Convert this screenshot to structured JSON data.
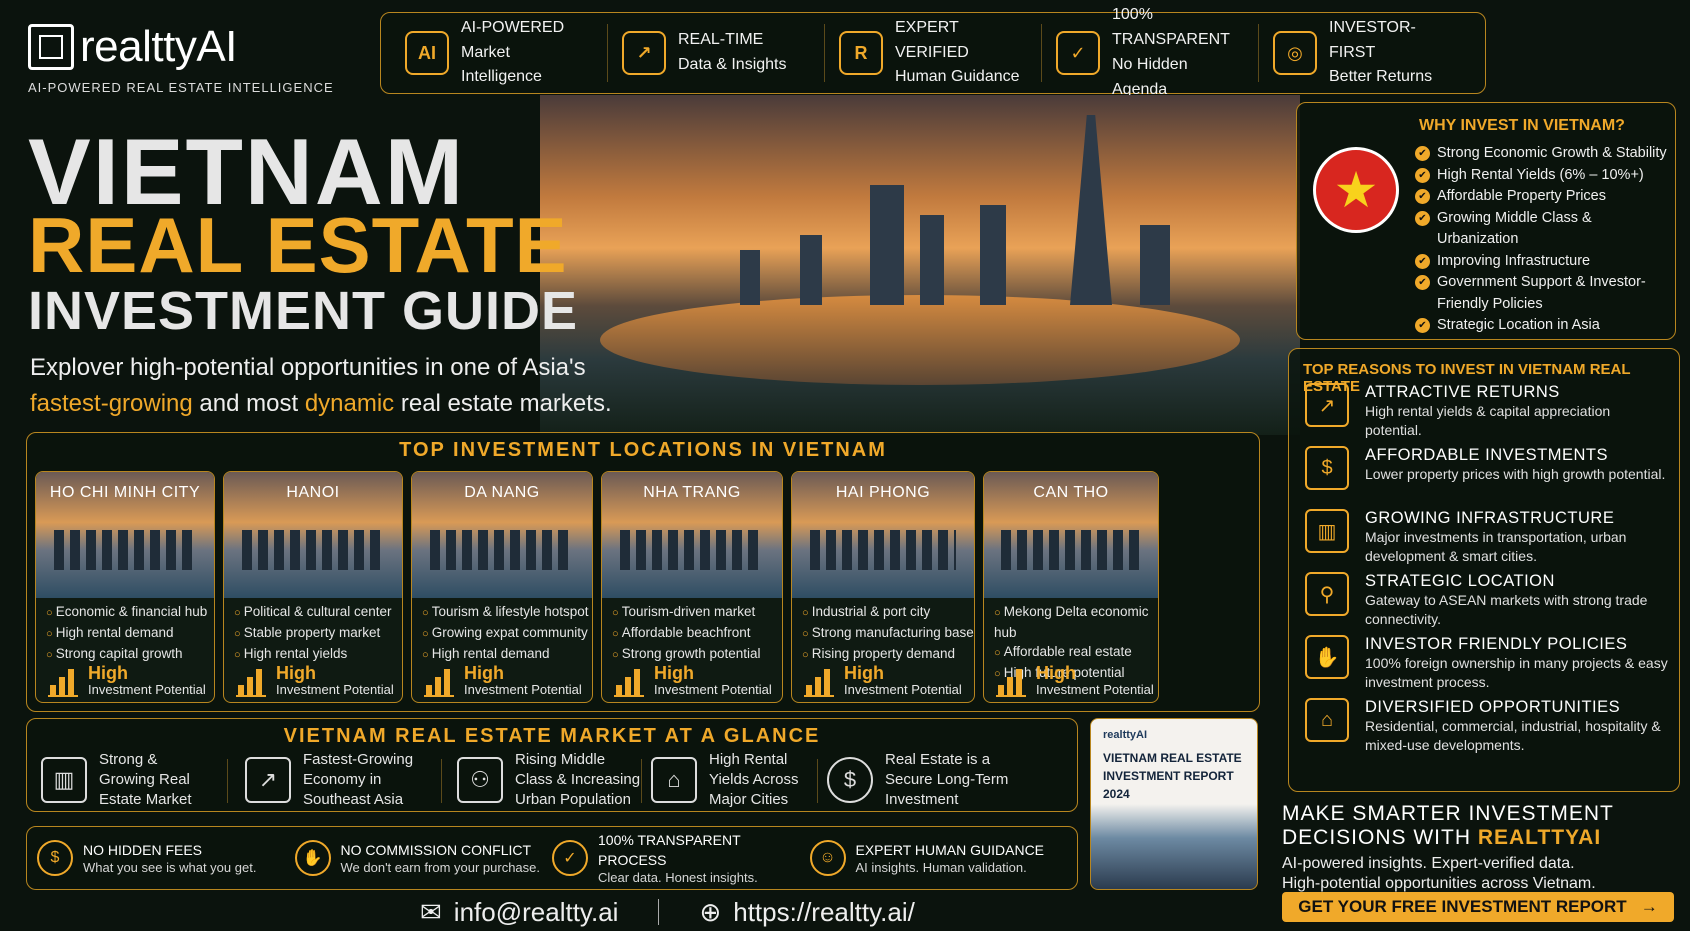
{
  "brand": {
    "name": "realttyAI",
    "tagline": "AI-POWERED REAL ESTATE INTELLIGENCE"
  },
  "features": [
    {
      "icon": "ai-chip-icon",
      "line1": "AI-POWERED",
      "line2": "Market Intelligence"
    },
    {
      "icon": "growth-chart-icon",
      "line1": "REAL-TIME",
      "line2": "Data & Insights"
    },
    {
      "icon": "expert-icon",
      "line1": "EXPERT VERIFIED",
      "line2": "Human Guidance"
    },
    {
      "icon": "shield-check-icon",
      "line1": "100% TRANSPARENT",
      "line2": "No Hidden Agenda"
    },
    {
      "icon": "target-icon",
      "line1": "INVESTOR-FIRST",
      "line2": "Better Returns"
    }
  ],
  "hero": {
    "title1": "VIETNAM",
    "title2": "REAL ESTATE",
    "title3": "INVESTMENT GUIDE",
    "subtitle_a": "Explover high-potential opportunities in one of Asia's",
    "subtitle_h1": "fastest-growing",
    "subtitle_b": " and most ",
    "subtitle_h2": "dynamic",
    "subtitle_c": " real estate markets."
  },
  "locations": {
    "title": "TOP INVESTMENT LOCATIONS IN VIETNAM",
    "cards": [
      {
        "name": "HO CHI MINH CITY",
        "points": [
          "Economic & financial hub",
          "High rental demand",
          "Strong capital growth"
        ],
        "potential": "High",
        "potential_label": "Investment Potential"
      },
      {
        "name": "HANOI",
        "points": [
          "Political & cultural center",
          "Stable property market",
          "High rental yields"
        ],
        "potential": "High",
        "potential_label": "Investment Potential"
      },
      {
        "name": "DA NANG",
        "points": [
          "Tourism & lifestyle hotspot",
          "Growing expat community",
          "High rental demand"
        ],
        "potential": "High",
        "potential_label": "Investment Potential"
      },
      {
        "name": "NHA TRANG",
        "points": [
          "Tourism-driven market",
          "Affordable beachfront",
          "Strong growth potential"
        ],
        "potential": "High",
        "potential_label": "Investment Potential"
      },
      {
        "name": "HAI PHONG",
        "points": [
          "Industrial & port city",
          "Strong manufacturing base",
          "Rising property demand"
        ],
        "potential": "High",
        "potential_label": "Investment Potential"
      },
      {
        "name": "CAN THO",
        "points": [
          "Mekong Delta economic hub",
          "Affordable real estate",
          "High future potential"
        ],
        "potential": "High",
        "potential_label": "Investment Potential"
      }
    ]
  },
  "glance": {
    "title": "VIETNAM REAL ESTATE MARKET AT A GLANCE",
    "items": [
      {
        "icon": "buildings-icon",
        "text": "Strong & Growing Real Estate Market"
      },
      {
        "icon": "growth-chart-icon",
        "text": "Fastest-Growing Economy in Southeast Asia"
      },
      {
        "icon": "people-icon",
        "text": "Rising Middle Class & Increasing Urban Population"
      },
      {
        "icon": "house-icon",
        "text": "High Rental Yields Across Major Cities"
      },
      {
        "icon": "dollar-icon",
        "text": "Real Estate is a Secure Long-Term Investment"
      }
    ]
  },
  "trust": [
    {
      "icon": "no-fees-icon",
      "title": "NO HIDDEN FEES",
      "sub": "What you see is what you get."
    },
    {
      "icon": "handshake-icon",
      "title": "NO COMMISSION CONFLICT",
      "sub": "We don't earn from your purchase."
    },
    {
      "icon": "shield-check-icon",
      "title": "100% TRANSPARENT PROCESS",
      "sub": "Clear data. Honest insights."
    },
    {
      "icon": "expert-icon",
      "title": "EXPERT HUMAN GUIDANCE",
      "sub": "AI insights. Human validation."
    }
  ],
  "report": {
    "brand": "realttyAI",
    "title": "VIETNAM REAL ESTATE INVESTMENT REPORT 2024"
  },
  "why": {
    "title": "WHY INVEST IN VIETNAM?",
    "items": [
      "Strong Economic Growth & Stability",
      "High Rental Yields (6% – 10%+)",
      "Affordable Property Prices",
      "Growing Middle Class & Urbanization",
      "Improving Infrastructure",
      "Government Support & Investor-Friendly Policies",
      "Strategic Location in Asia"
    ]
  },
  "reasons": {
    "title": "TOP REASONS TO INVEST IN VIETNAM REAL ESTATE",
    "items": [
      {
        "icon": "growth-chart-icon",
        "head": "ATTRACTIVE RETURNS",
        "desc": "High rental yields & capital appreciation potential."
      },
      {
        "icon": "dollar-hand-icon",
        "head": "AFFORDABLE INVESTMENTS",
        "desc": "Lower property prices with high growth potential."
      },
      {
        "icon": "buildings-icon",
        "head": "GROWING INFRASTRUCTURE",
        "desc": "Major investments in transportation, urban development & smart cities."
      },
      {
        "icon": "location-pin-icon",
        "head": "STRATEGIC LOCATION",
        "desc": "Gateway to ASEAN markets with strong trade connectivity."
      },
      {
        "icon": "handshake-icon",
        "head": "INVESTOR FRIENDLY POLICIES",
        "desc": "100% foreign ownership in many projects & easy investment process."
      },
      {
        "icon": "house-icon",
        "head": "DIVERSIFIED OPPORTUNITIES",
        "desc": "Residential, commercial, industrial, hospitality & mixed-use developments."
      }
    ]
  },
  "smart": {
    "line1": "MAKE SMARTER INVESTMENT",
    "line2a": "DECISIONS WITH ",
    "line2b": "REALTTYAI",
    "line3": "AI-powered insights. Expert-verified data.",
    "line4": "High-potential opportunities across Vietnam."
  },
  "cta": {
    "label": "GET YOUR FREE INVESTMENT REPORT",
    "arrow": "→"
  },
  "footer": {
    "email": "info@realtty.ai",
    "url": "https://realtty.ai/"
  },
  "colors": {
    "accent": "#f0a92a",
    "background": "#0b130d",
    "flag_red": "#d8261f"
  }
}
